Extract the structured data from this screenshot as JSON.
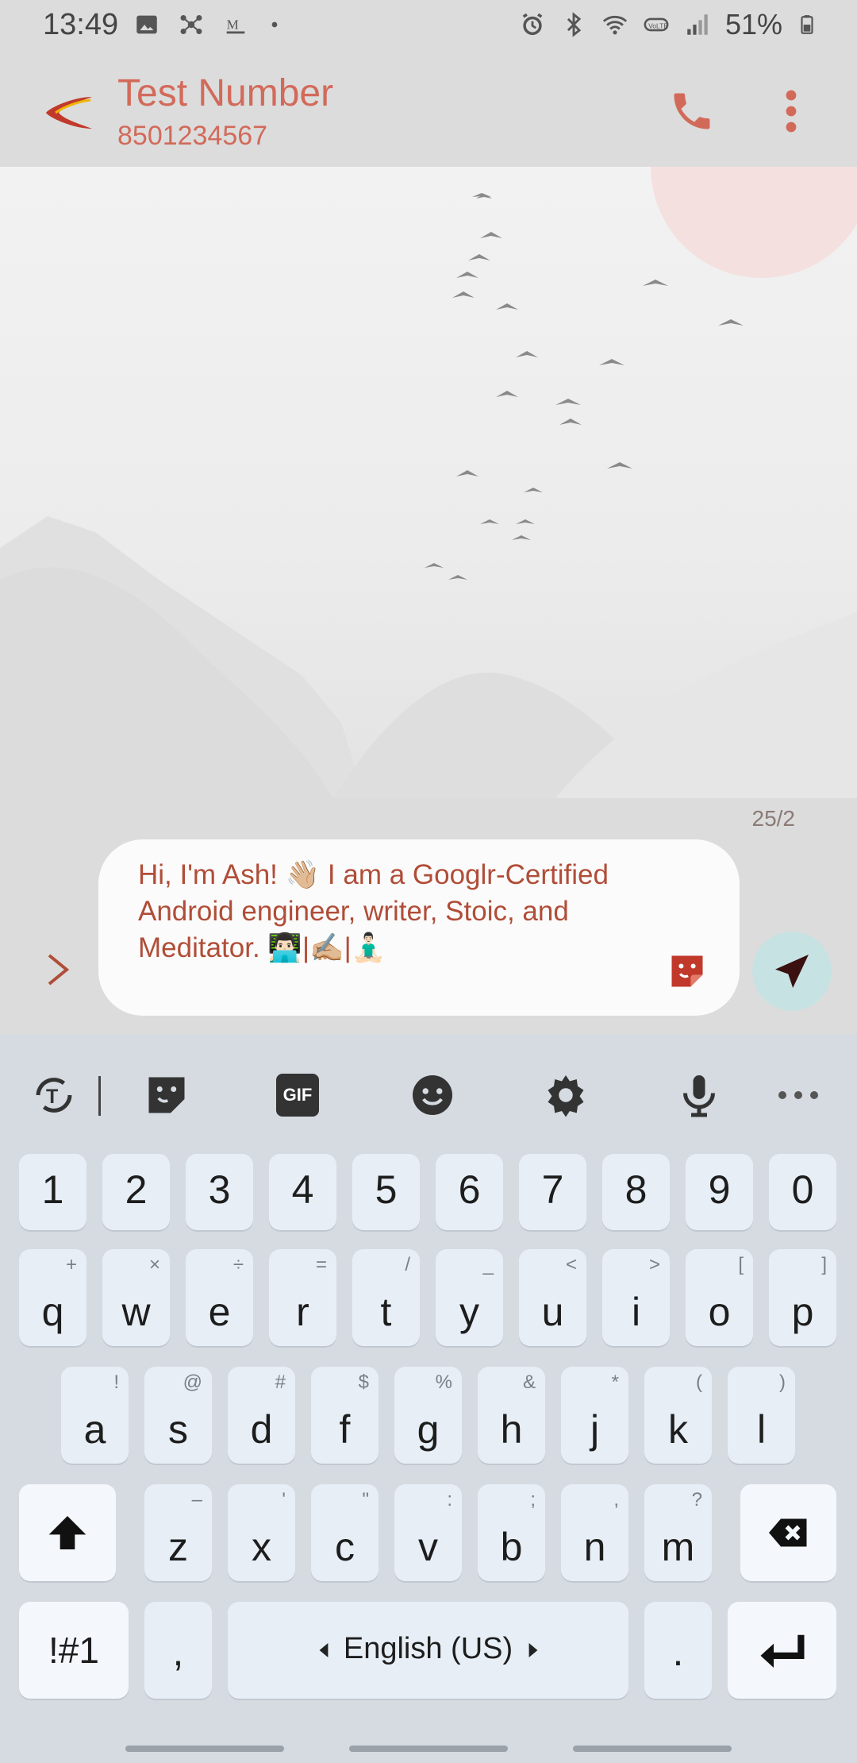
{
  "status_bar": {
    "time": "13:49",
    "battery": "51%",
    "icons": [
      "image-icon",
      "network-icon",
      "medium-icon",
      "dot-icon",
      "alarm-icon",
      "bluetooth-icon",
      "wifi-icon",
      "volte-icon",
      "signal-icon",
      "battery-icon"
    ]
  },
  "header": {
    "contact_name": "Test Number",
    "contact_number": "8501234567",
    "accent_color": "#d26a5a"
  },
  "composer": {
    "char_count": "25/2",
    "message_text": "Hi, I'm Ash! 👋🏼 I am a Googlr-Certified Android engineer, writer, Stoic, and Meditator. 👨🏻‍💻|✍🏼|🧘🏻‍♂️",
    "text_color": "#b04d38"
  },
  "keyboard": {
    "toolbar": [
      "text-tools-icon",
      "sticker-icon",
      "gif-icon",
      "emoji-icon",
      "settings-icon",
      "mic-icon",
      "more-icon"
    ],
    "gif_label": "GIF",
    "number_row": [
      "1",
      "2",
      "3",
      "4",
      "5",
      "6",
      "7",
      "8",
      "9",
      "0"
    ],
    "row1": [
      {
        "key": "q",
        "hint": "+"
      },
      {
        "key": "w",
        "hint": "×"
      },
      {
        "key": "e",
        "hint": "÷"
      },
      {
        "key": "r",
        "hint": "="
      },
      {
        "key": "t",
        "hint": "/"
      },
      {
        "key": "y",
        "hint": "_"
      },
      {
        "key": "u",
        "hint": "<"
      },
      {
        "key": "i",
        "hint": ">"
      },
      {
        "key": "o",
        "hint": "["
      },
      {
        "key": "p",
        "hint": "]"
      }
    ],
    "row2": [
      {
        "key": "a",
        "hint": "!"
      },
      {
        "key": "s",
        "hint": "@"
      },
      {
        "key": "d",
        "hint": "#"
      },
      {
        "key": "f",
        "hint": "$"
      },
      {
        "key": "g",
        "hint": "%"
      },
      {
        "key": "h",
        "hint": "&"
      },
      {
        "key": "j",
        "hint": "*"
      },
      {
        "key": "k",
        "hint": "("
      },
      {
        "key": "l",
        "hint": ")"
      }
    ],
    "row3": [
      {
        "key": "z",
        "hint": "–"
      },
      {
        "key": "x",
        "hint": "'"
      },
      {
        "key": "c",
        "hint": "\""
      },
      {
        "key": "v",
        "hint": ":"
      },
      {
        "key": "b",
        "hint": ";"
      },
      {
        "key": "n",
        "hint": ","
      },
      {
        "key": "m",
        "hint": "?"
      }
    ],
    "symbols_label": "!#1",
    "comma_label": ",",
    "space_label": "English (US)",
    "period_label": "."
  }
}
